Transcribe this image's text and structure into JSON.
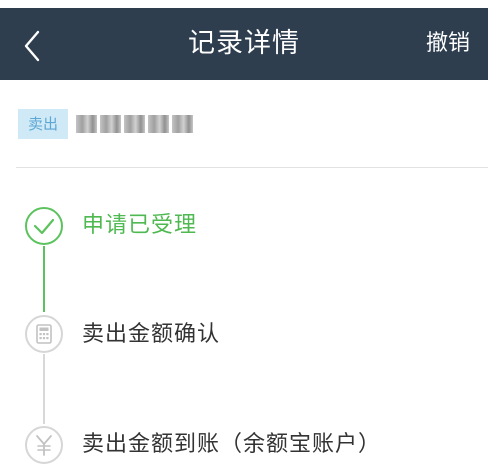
{
  "header": {
    "title": "记录详情",
    "cancel_label": "撤销",
    "background": "#2e3e4f",
    "back_icon": "chevron-left-icon"
  },
  "record": {
    "type_tag": "卖出",
    "tag_background": "#cfe9f7",
    "tag_color": "#5da7d4"
  },
  "timeline": {
    "active_color": "#4fb951",
    "steps": [
      {
        "label": "申请已受理",
        "status": "done",
        "icon": "check-circle-icon"
      },
      {
        "label": "卖出金额确认",
        "status": "pending",
        "icon": "calculator-icon"
      },
      {
        "label": "卖出金额到账（余额宝账户）",
        "status": "pending",
        "icon": "yuan-icon"
      }
    ]
  }
}
